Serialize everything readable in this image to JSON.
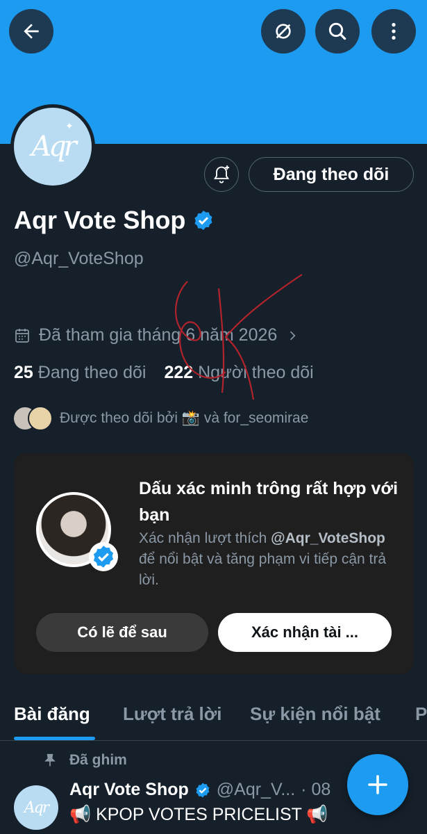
{
  "header": {
    "back_icon": "arrow-left-icon",
    "grok_icon": "slash-circle-icon",
    "search_icon": "search-icon",
    "more_icon": "more-vertical-icon"
  },
  "profile": {
    "avatar_text": "Aqr",
    "name": "Aqr Vote Shop",
    "handle": "@Aqr_VoteShop",
    "follow_state_label": "Đang theo dõi",
    "joined": "Đã tham gia tháng 6 năm 2026",
    "following_count": "25",
    "following_label": "Đang theo dõi",
    "followers_count": "222",
    "followers_label": "Người theo dõi",
    "followed_by": "Được theo dõi bởi 📸 và for_seomirae"
  },
  "verify_card": {
    "title": "Dấu xác minh trông rất hợp với bạn",
    "desc_prefix": "Xác nhận lượt thích",
    "desc_handle": "@Aqr_VoteShop",
    "desc_suffix": "để nổi bật và tăng phạm vi tiếp cận trả lời.",
    "later_label": "Có lẽ để sau",
    "confirm_label": "Xác nhận tài ..."
  },
  "tabs": [
    {
      "label": "Bài đăng",
      "active": true
    },
    {
      "label": "Lượt trả lời",
      "active": false
    },
    {
      "label": "Sự kiện nổi bật",
      "active": false
    },
    {
      "label": "P",
      "active": false
    }
  ],
  "pinned_post": {
    "pinned_label": "Đã ghim",
    "author": "Aqr Vote Shop",
    "handle": "@Aqr_V...",
    "time": "· 08",
    "text": "📢 KPOP VOTES PRICELIST 📢",
    "avatar_text": "Aqr"
  },
  "colors": {
    "accent": "#1d9bf0",
    "background": "#15202b",
    "muted": "#8b98a5"
  }
}
